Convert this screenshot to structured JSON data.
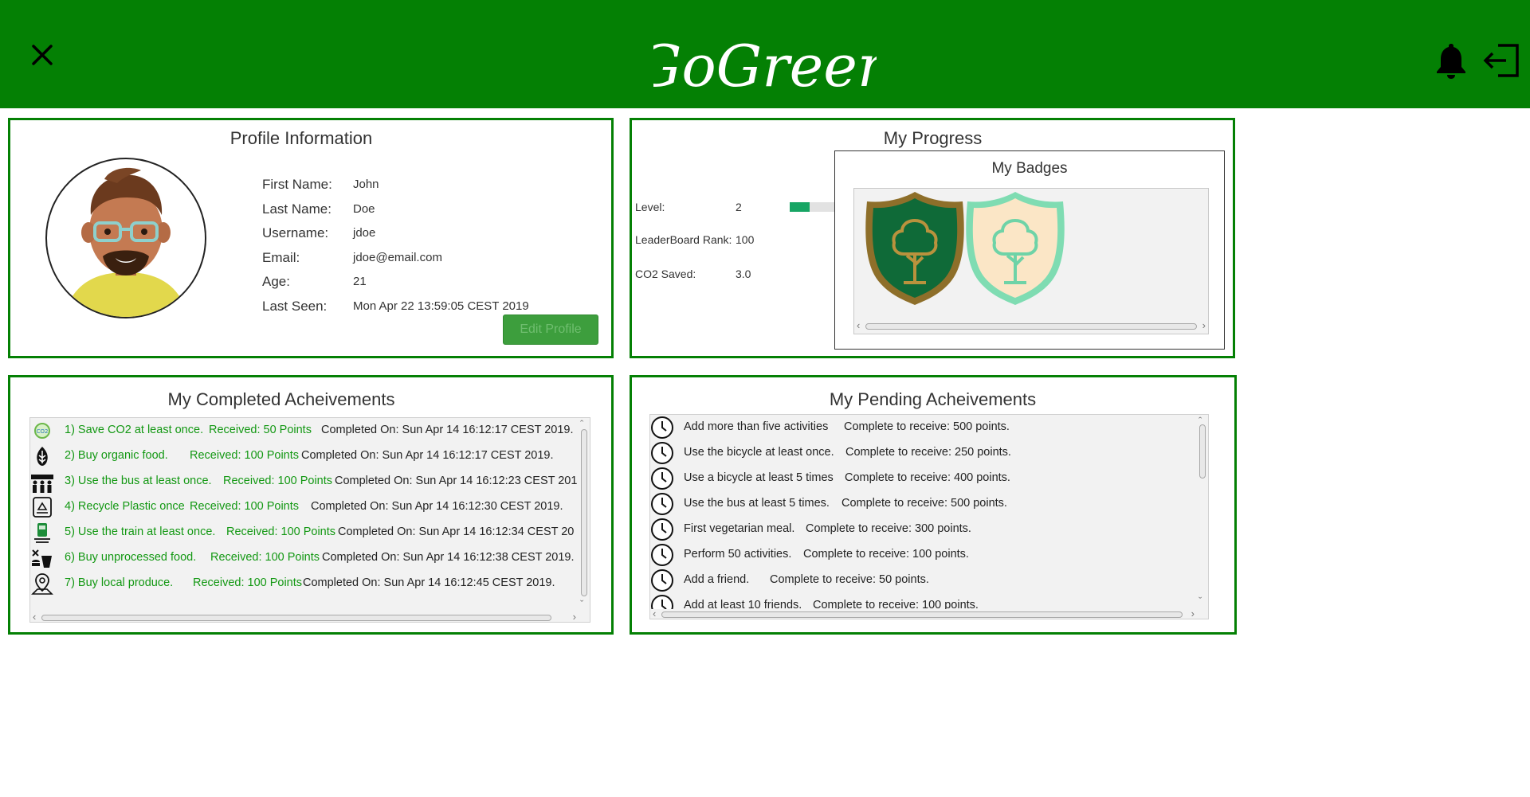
{
  "header": {
    "brand": "GoGreen",
    "close_icon": "close-icon",
    "notifications_icon": "bell-icon",
    "logout_icon": "logout-icon",
    "brand_color": "#048004"
  },
  "profile": {
    "title": "Profile Information",
    "fields": [
      {
        "label": "First Name:",
        "value": "John"
      },
      {
        "label": "Last Name:",
        "value": "Doe"
      },
      {
        "label": "Username:",
        "value": "jdoe"
      },
      {
        "label": "Email:",
        "value": "jdoe@email.com"
      },
      {
        "label": "Age:",
        "value": "21"
      },
      {
        "label": "Last Seen:",
        "value": "Mon Apr 22 13:59:05 CEST 2019"
      }
    ],
    "edit_button": "Edit Profile"
  },
  "progress": {
    "title": "My Progress",
    "level_label": "Level:",
    "level_value": "2",
    "level_progress": 0.45,
    "rank_label": "LeaderBoard Rank:",
    "rank_value": "100",
    "co2_label": "CO2 Saved:",
    "co2_value": "3.0",
    "badges_title": "My Badges",
    "badges": [
      "tree-badge-dark",
      "tree-badge-light"
    ]
  },
  "completed": {
    "title": "My Completed Acheivements",
    "items": [
      {
        "icon": "co2-icon",
        "name": "1) Save CO2 at least once.",
        "reward": "Received: 50 Points",
        "completed": "Completed On: Sun Apr 14 16:12:17 CEST 2019."
      },
      {
        "icon": "organic-food-icon",
        "name": "2) Buy organic food.",
        "reward": "Received: 100 Points",
        "completed": "Completed On: Sun Apr 14 16:12:17 CEST 2019."
      },
      {
        "icon": "bus-icon",
        "name": "3) Use the bus at least once.",
        "reward": "Received: 100 Points",
        "completed": "Completed On: Sun Apr 14 16:12:23 CEST 201"
      },
      {
        "icon": "recycle-icon",
        "name": "4) Recycle Plastic once",
        "reward": "Received: 100 Points",
        "completed": "Completed On: Sun Apr 14 16:12:30 CEST 2019."
      },
      {
        "icon": "train-icon",
        "name": "5) Use the train at least once.",
        "reward": "Received: 100 Points",
        "completed": "Completed On: Sun Apr 14 16:12:34 CEST 20"
      },
      {
        "icon": "unprocessed-food-icon",
        "name": "6) Buy unprocessed food.",
        "reward": "Received: 100 Points",
        "completed": "Completed On: Sun Apr 14 16:12:38 CEST 2019."
      },
      {
        "icon": "location-pin-icon",
        "name": "7) Buy local produce.",
        "reward": "Received: 100 Points",
        "completed": "Completed On: Sun Apr 14 16:12:45 CEST 2019."
      }
    ]
  },
  "pending": {
    "title": "My Pending Acheivements",
    "items": [
      {
        "name": "Add more than five activities",
        "reward": "Complete to receive: 500 points."
      },
      {
        "name": "Use the bicycle at least once.",
        "reward": "Complete to receive: 250 points."
      },
      {
        "name": "Use a bicycle at least 5 times",
        "reward": "Complete to receive: 400 points."
      },
      {
        "name": "Use the bus at least 5 times.",
        "reward": "Complete to receive: 500 points."
      },
      {
        "name": "First vegetarian meal.",
        "reward": "Complete to receive: 300 points."
      },
      {
        "name": "Perform 50 activities.",
        "reward": "Complete to receive: 100 points."
      },
      {
        "name": "Add a friend.",
        "reward": "Complete to receive: 50 points."
      },
      {
        "name": "Add at least 10 friends.",
        "reward": "Complete to receive: 100 points."
      }
    ]
  }
}
